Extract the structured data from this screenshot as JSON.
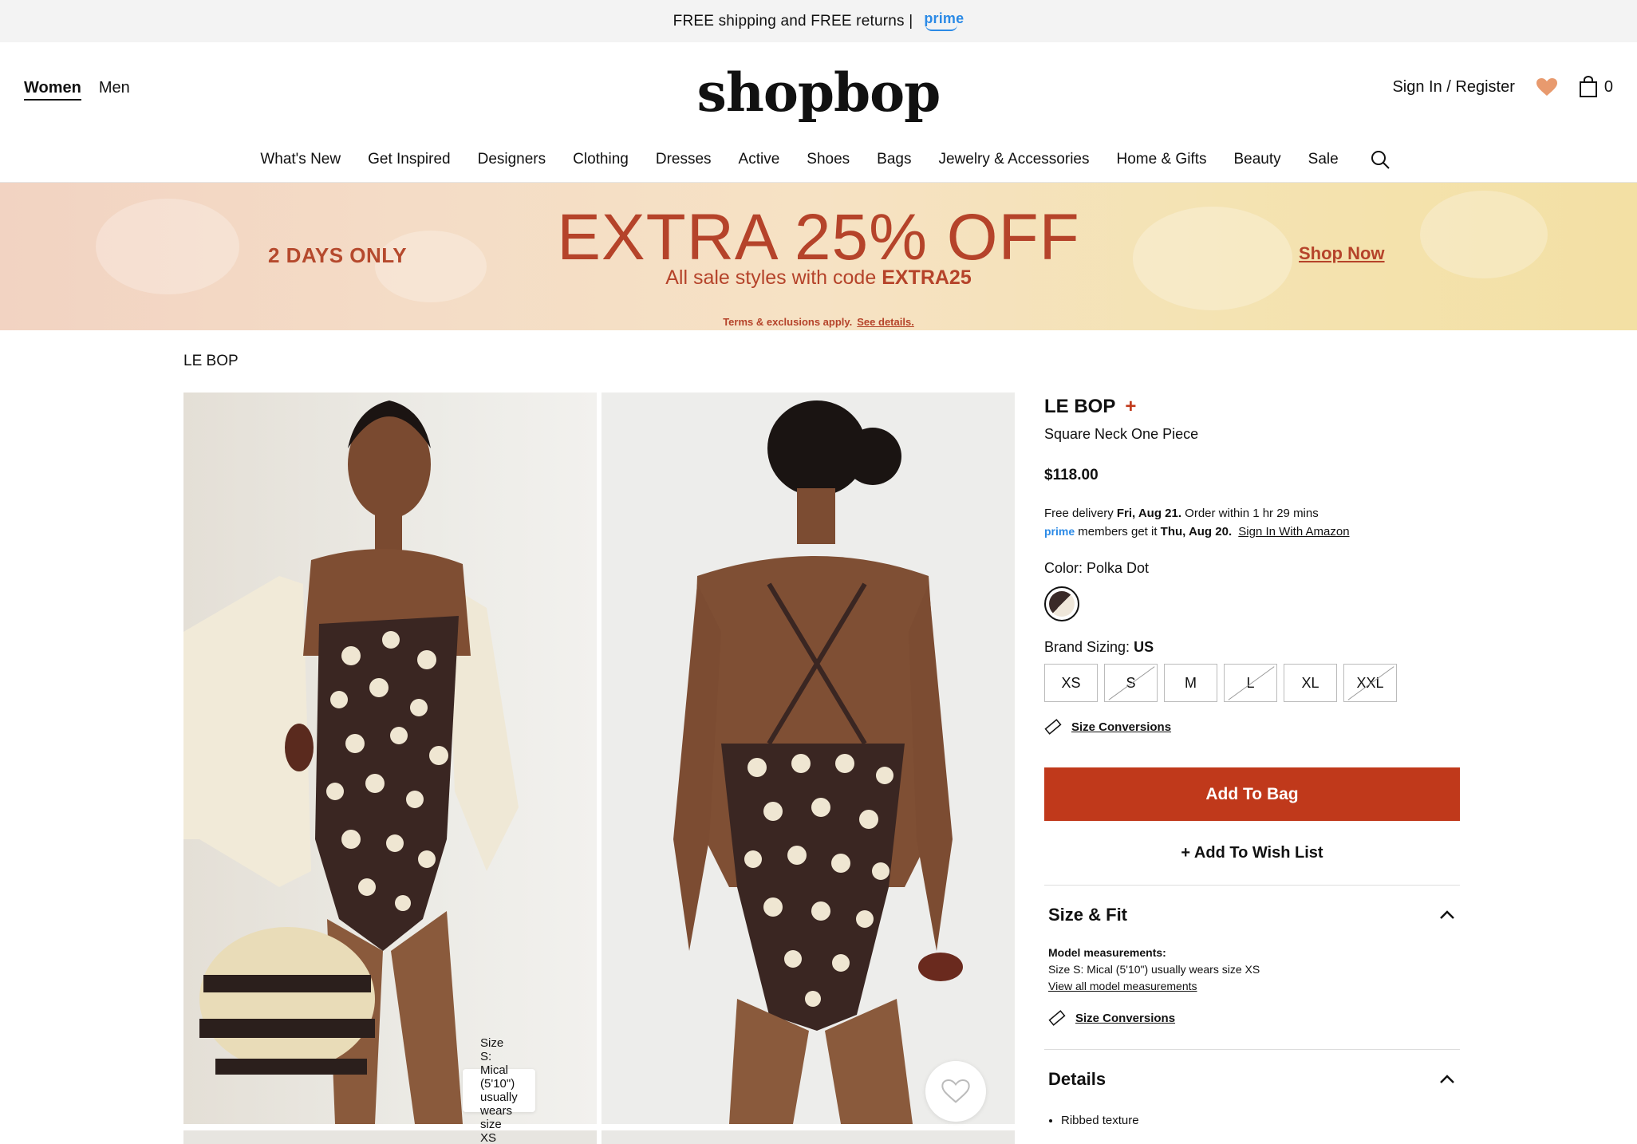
{
  "topbar": {
    "text": "FREE shipping and FREE returns |",
    "prime": "prime"
  },
  "header": {
    "gender_tabs": [
      "Women",
      "Men"
    ],
    "logo": "shopbop",
    "account": "Sign In / Register",
    "bag_count": "0"
  },
  "nav": [
    "What's New",
    "Get Inspired",
    "Designers",
    "Clothing",
    "Dresses",
    "Active",
    "Shoes",
    "Bags",
    "Jewelry & Accessories",
    "Home & Gifts",
    "Beauty",
    "Sale"
  ],
  "promo": {
    "left": "2 DAYS ONLY",
    "headline": "EXTRA 25% OFF",
    "sub": "All sale styles with code",
    "code": "EXTRA25",
    "terms": "Terms & exclusions apply.",
    "terms_link": "See details.",
    "cta": "Shop Now"
  },
  "breadcrumb": "LE BOP",
  "gallery": {
    "tooltip": "Size S: Mical (5'10\") usually wears size XS"
  },
  "product": {
    "brand": "LE BOP",
    "brand_plus": "+",
    "name": "Square Neck One Piece",
    "price": "$118.00",
    "delivery_1a": "Free delivery",
    "delivery_1b": "Fri, Aug 21.",
    "delivery_1c": "Order within 1 hr 29 mins",
    "delivery_prime": "prime",
    "delivery_2a": "members get it",
    "delivery_2b": "Thu, Aug 20.",
    "delivery_2c": "Sign In With Amazon",
    "color_label": "Color: Polka Dot",
    "size_label": "Brand Sizing:",
    "size_system": "US",
    "sizes": [
      "XS",
      "S",
      "M",
      "L",
      "XL",
      "XXL"
    ],
    "size_conversions": "Size Conversions",
    "add_to_bag": "Add To Bag",
    "add_to_wish": "+ Add To Wish List"
  },
  "size_fit": {
    "title": "Size & Fit",
    "model_heading": "Model measurements:",
    "model_line": "Size S: Mical (5'10\") usually wears size XS",
    "view_all": "View all model measurements",
    "conversions": "Size Conversions"
  },
  "details": {
    "title": "Details",
    "items": [
      "Ribbed texture"
    ]
  },
  "colors": {
    "accent": "#c0391b",
    "prime_blue": "#2b8ae6",
    "wishlist_heart": "#e89a6e"
  }
}
